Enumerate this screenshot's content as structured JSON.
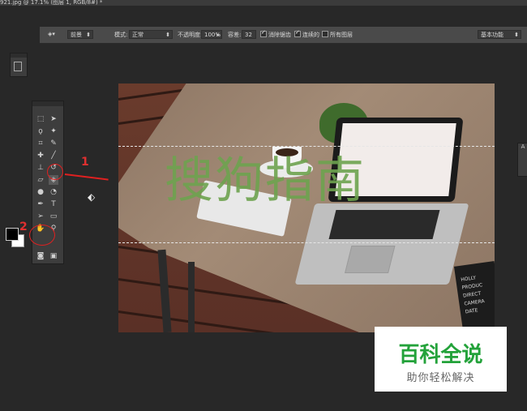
{
  "tab": {
    "title": "921.jpg @ 17.1% (图层 1, RGB/8#) *"
  },
  "options_bar": {
    "fill_source": "前景",
    "mode_label": "模式:",
    "mode_value": "正常",
    "opacity_label": "不透明度:",
    "opacity_value": "100%",
    "tolerance_label": "容差:",
    "tolerance_value": "32",
    "antialias_label": "消除锯齿",
    "contiguous_label": "连续的",
    "all_layers_label": "所有图层",
    "workspace": "基本功能"
  },
  "canvas": {
    "watermark": "搜狗指南"
  },
  "clapper_text": [
    "HOLLY",
    "PRODUC",
    "DIRECT",
    "CAMERA",
    "DATE"
  ],
  "annotations": {
    "label_1": "1",
    "label_2": "2"
  },
  "right_panel": {
    "label": "A"
  },
  "badge": {
    "title": "百科全说",
    "subtitle": "助你轻松解决"
  },
  "colors": {
    "accent_red": "#e02020",
    "watermark_green": "#6ea34f",
    "badge_green": "#23a23a"
  },
  "icons": {
    "bucket": "paint-bucket-icon",
    "move": "move-icon",
    "marquee": "marquee-icon",
    "lasso": "lasso-icon",
    "crop": "crop-icon",
    "eyedropper": "eyedropper-icon",
    "brush": "brush-icon",
    "stamp": "clone-stamp-icon",
    "eraser": "eraser-icon",
    "blur": "blur-icon",
    "dodge": "dodge-icon",
    "pen": "pen-icon",
    "type": "type-icon",
    "path_select": "path-select-icon",
    "shape": "shape-icon",
    "hand": "hand-icon",
    "zoom": "zoom-icon"
  }
}
